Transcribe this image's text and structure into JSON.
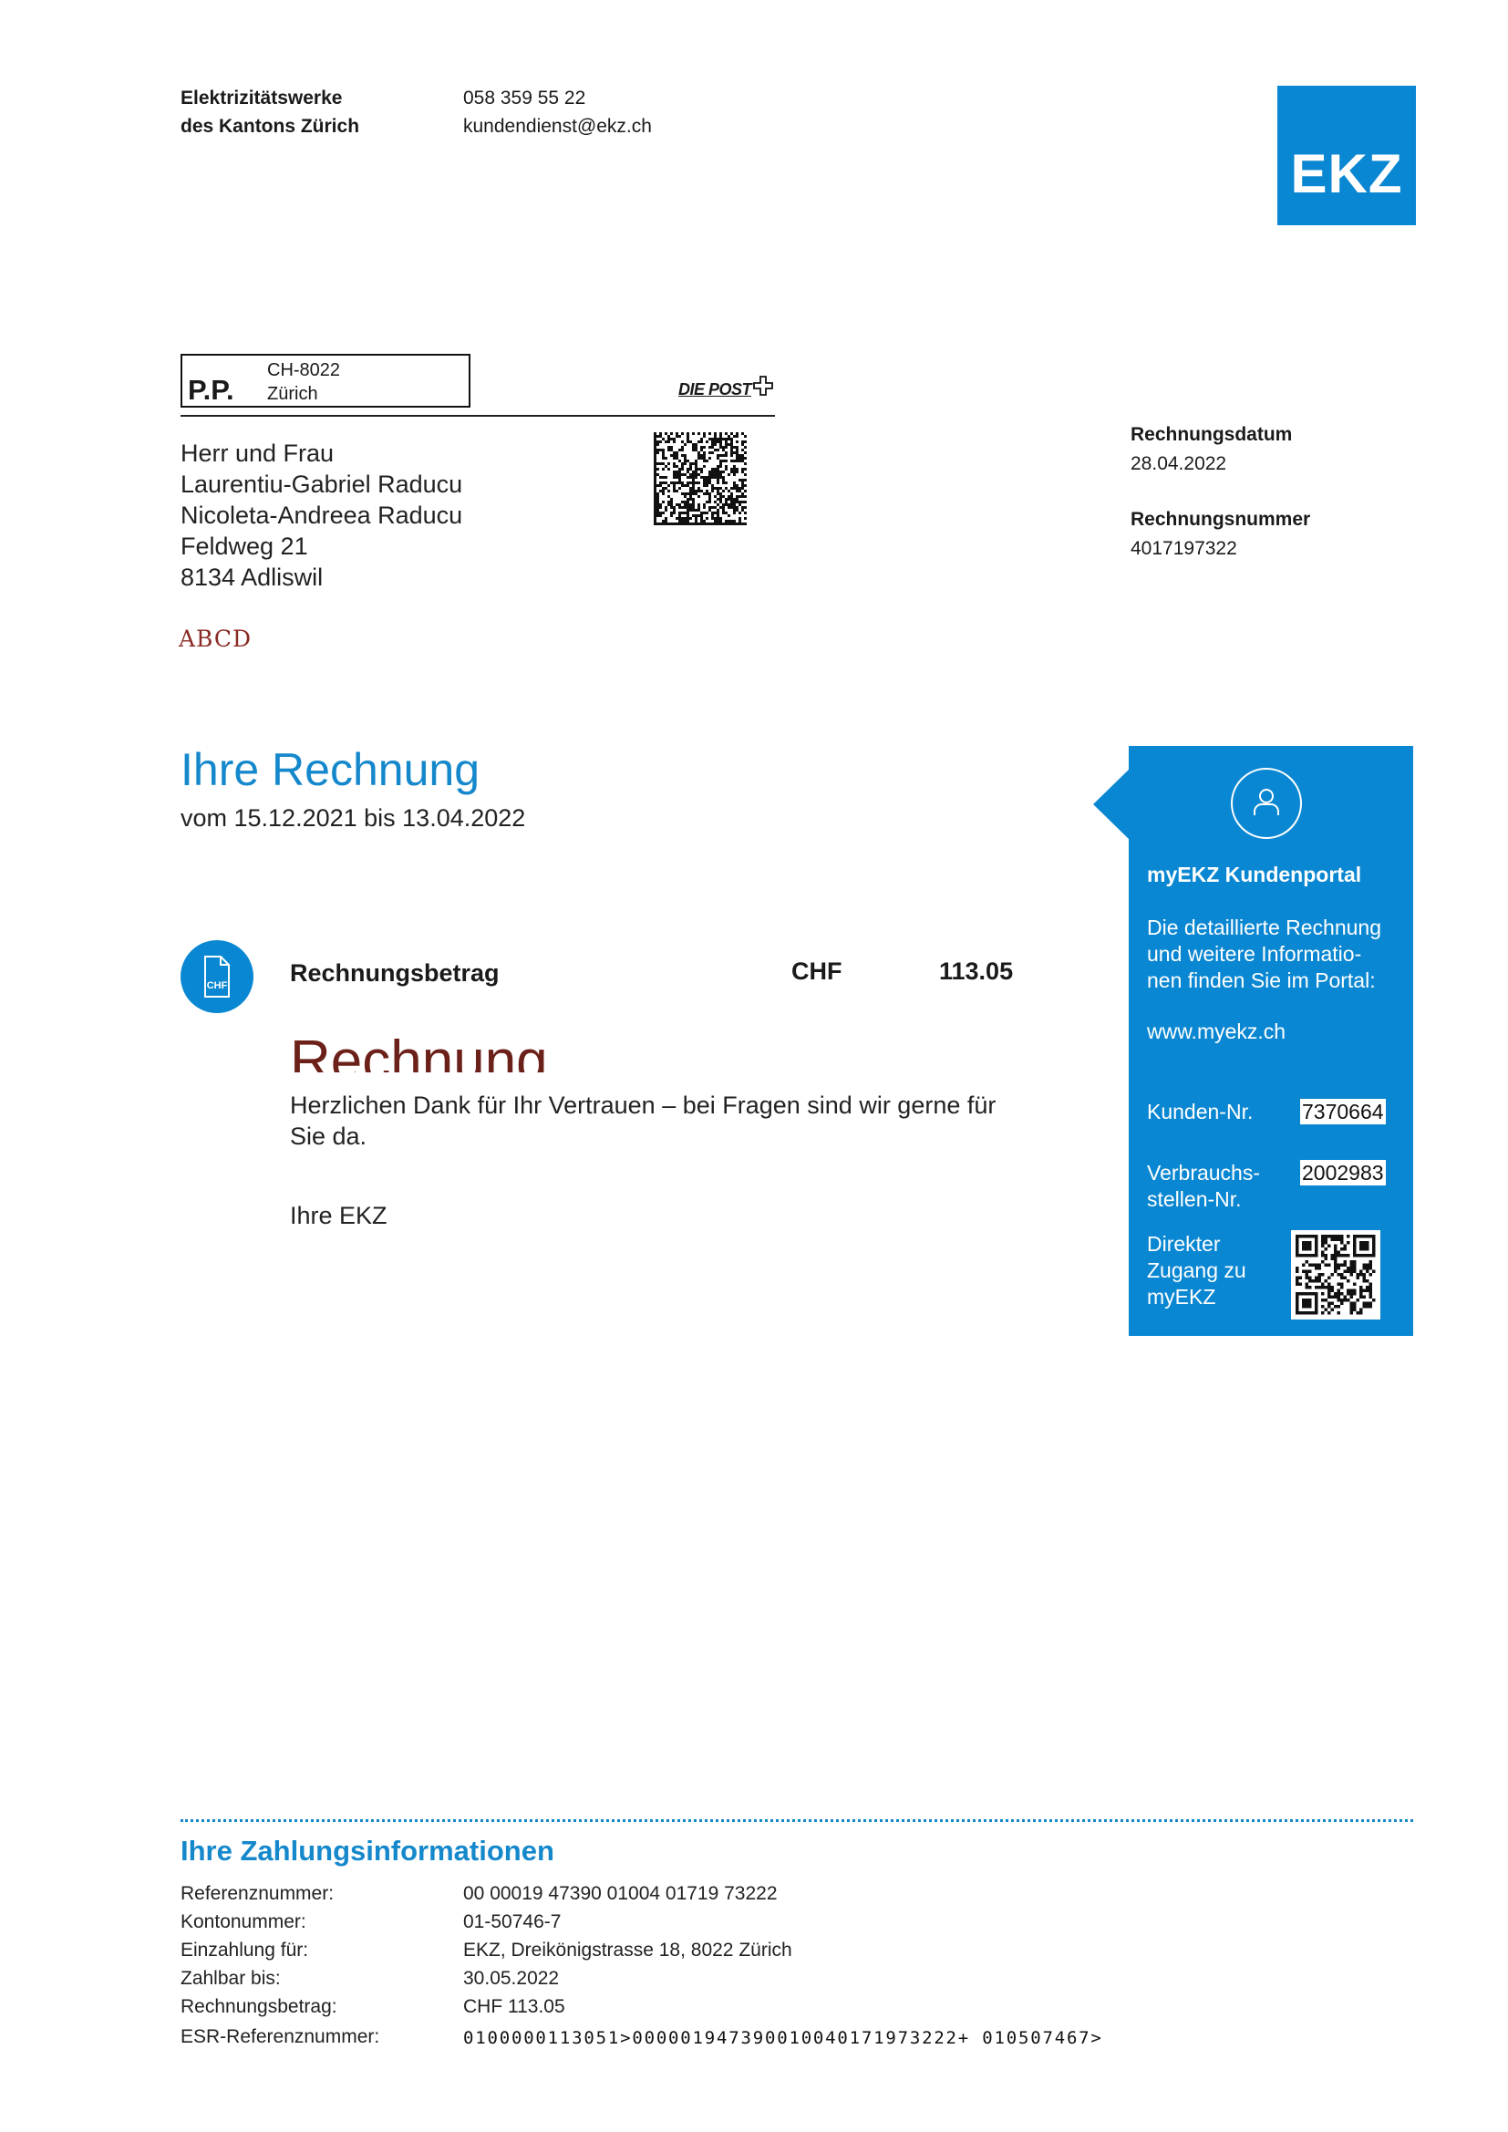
{
  "sender": {
    "name_line1": "Elektrizitätswerke",
    "name_line2": "des Kantons Zürich",
    "phone": "058 359 55 22",
    "email": "kundendienst@ekz.ch",
    "logo_text": "EKZ"
  },
  "postage": {
    "pp_label": "P.P.",
    "pp_code_line1": "CH-8022",
    "pp_code_line2": "Zürich",
    "post_logo": "DIE POST"
  },
  "recipient": {
    "salutation": "Herr und Frau",
    "name1": "Laurentiu-Gabriel Raducu",
    "name2": "Nicoleta-Andreea Raducu",
    "street": "Feldweg 21",
    "city": "8134 Adliswil",
    "stamp": "ABCD"
  },
  "invoice_meta": {
    "date_label": "Rechnungsdatum",
    "date_value": "28.04.2022",
    "number_label": "Rechnungsnummer",
    "number_value": "4017197322"
  },
  "main": {
    "title": "Ihre Rechnung",
    "period": "vom 15.12.2021 bis 13.04.2022",
    "icon_label": "CHF",
    "amount_label": "Rechnungsbetrag",
    "amount_currency": "CHF",
    "amount_value": "113.05",
    "overlay_word": "Rechnung",
    "thanks": "Herzlichen Dank für Ihr Vertrauen – bei Fragen sind wir gerne für Sie da.",
    "closing": "Ihre EKZ"
  },
  "portal": {
    "title": "myEKZ Kundenportal",
    "text": "Die detaillierte Rechnung und weitere Informatio-nen finden Sie im Portal:",
    "text_line1": "Die detaillierte Rechnung",
    "text_line2": "und weitere Informatio-",
    "text_line3": "nen finden Sie im Portal:",
    "url": "www.myekz.ch",
    "customer_label": "Kunden-Nr.",
    "customer_value": "7370664",
    "site_label_line1": "Verbrauchs-",
    "site_label_line2": "stellen-Nr.",
    "site_value": "2002983",
    "access_line1": "Direkter",
    "access_line2": "Zugang zu",
    "access_line3": "myEKZ"
  },
  "payment": {
    "title": "Ihre Zahlungsinformationen",
    "rows": [
      {
        "label": "Referenznummer:",
        "value": "00 00019 47390 01004 01719 73222"
      },
      {
        "label": "Kontonummer:",
        "value": "01-50746-7"
      },
      {
        "label": "Einzahlung für:",
        "value": "EKZ, Dreikönigstrasse 18, 8022 Zürich"
      },
      {
        "label": "Zahlbar bis:",
        "value": "30.05.2022"
      },
      {
        "label": "Rechnungsbetrag:",
        "value": "CHF 113.05"
      },
      {
        "label": "ESR-Referenznummer:",
        "value": "0100000113051>000001947390010040171973222+ 010507467>"
      }
    ]
  },
  "colors": {
    "brand_blue": "#0a87d2",
    "title_blue": "#1588cc",
    "overlay_red": "#6b2119"
  }
}
